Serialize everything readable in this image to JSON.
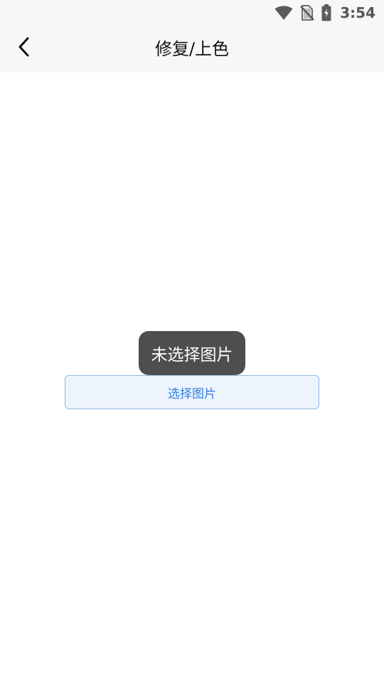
{
  "status_bar": {
    "time": "3:54",
    "icons": [
      "wifi-icon",
      "no-sim-icon",
      "battery-charging-icon"
    ]
  },
  "app_bar": {
    "back_icon": "chevron-left-icon",
    "title": "修复/上色"
  },
  "main": {
    "select_image_button_label": "选择图片",
    "toast_text": "未选择图片"
  },
  "colors": {
    "status_bar_bg": "#f7f7f7",
    "app_bar_bg": "#f7f7f7",
    "button_bg": "#edf4fe",
    "button_border": "#8fb8e8",
    "button_text": "#2f7fe0",
    "toast_bg": "#4e4e4e",
    "toast_text": "#ffffff"
  }
}
